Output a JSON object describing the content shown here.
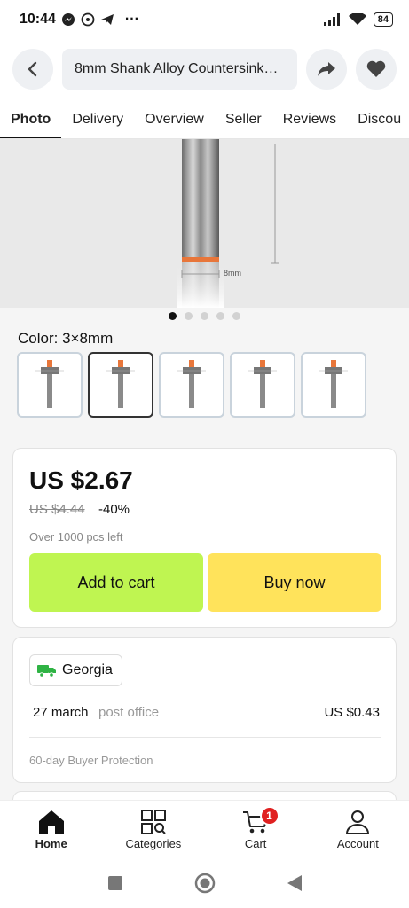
{
  "status": {
    "time": "10:44",
    "battery": "84"
  },
  "header": {
    "title": "8mm Shank Alloy Countersink…"
  },
  "tabs": [
    {
      "label": "Photo"
    },
    {
      "label": "Delivery"
    },
    {
      "label": "Overview"
    },
    {
      "label": "Seller"
    },
    {
      "label": "Reviews"
    },
    {
      "label": "Discou"
    }
  ],
  "gallery": {
    "dimension_label": "8mm",
    "active_index": 0,
    "count": 5
  },
  "color": {
    "label": "Color: 3×8mm",
    "selected_index": 1,
    "thumb_count": 5
  },
  "price": {
    "current": "US $2.67",
    "original": "US $4.44",
    "discount": "-40%",
    "stock": "Over 1000 pcs left"
  },
  "actions": {
    "add_to_cart": "Add to cart",
    "buy_now": "Buy now"
  },
  "shipping": {
    "country": "Georgia",
    "date": "27 march",
    "method": "post office",
    "price": "US $0.43",
    "protection": "60-day Buyer Protection"
  },
  "bottom_nav": {
    "items": [
      {
        "label": "Home"
      },
      {
        "label": "Categories"
      },
      {
        "label": "Cart"
      },
      {
        "label": "Account"
      }
    ],
    "cart_badge": "1"
  },
  "colors": {
    "cart_button": "#bff551",
    "buy_button": "#ffe35b",
    "badge": "#e02020",
    "ship_icon": "#2fb344"
  }
}
